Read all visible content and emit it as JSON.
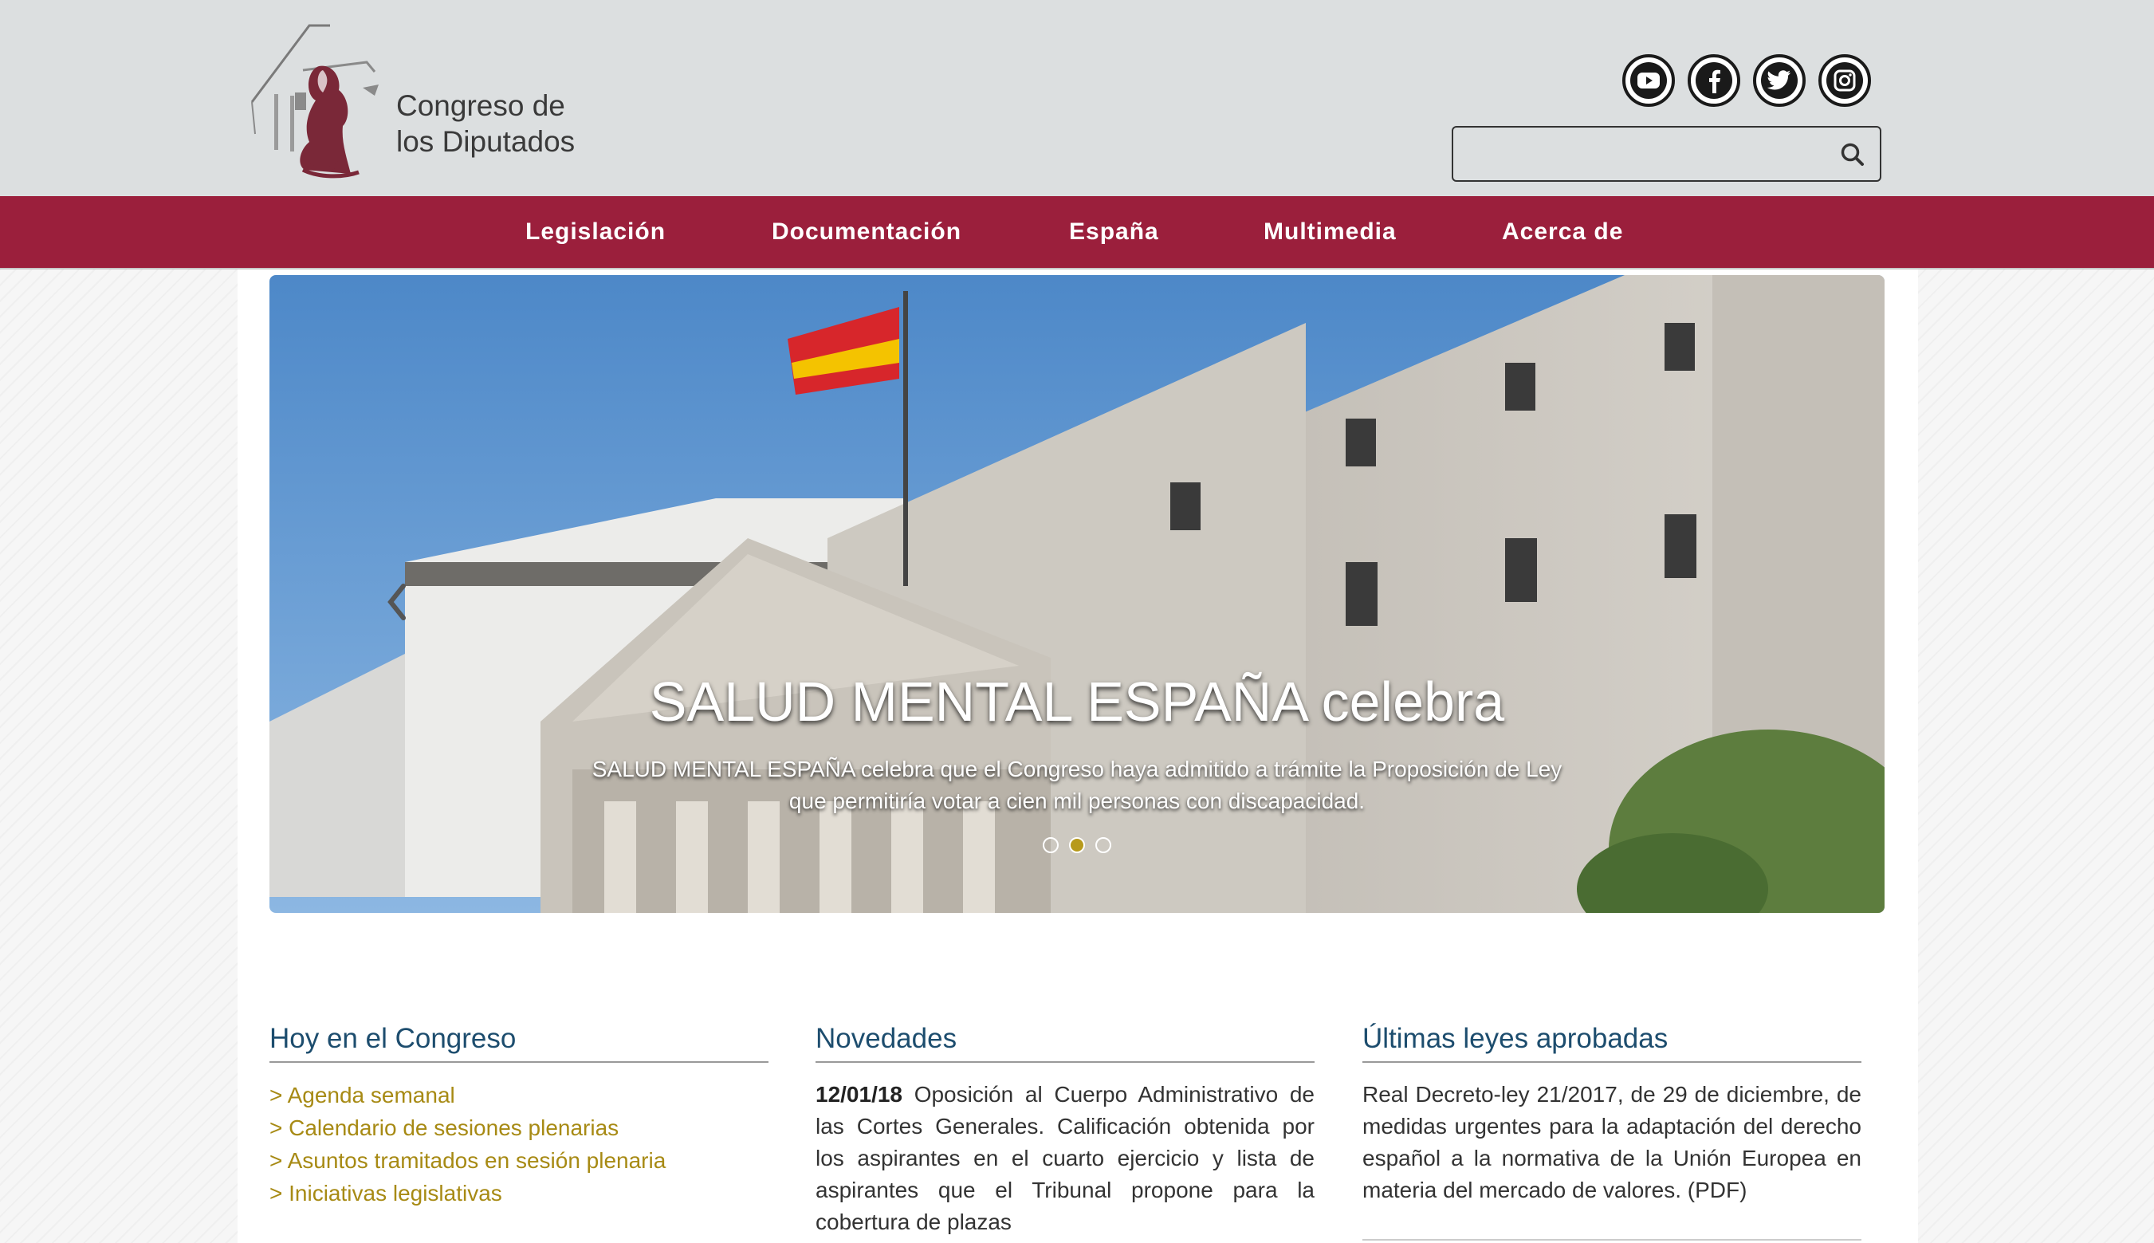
{
  "header": {
    "logo_line1": "Congreso de",
    "logo_line2": "los Diputados",
    "social": [
      "youtube-icon",
      "facebook-icon",
      "twitter-icon",
      "instagram-icon"
    ],
    "search": {
      "value": "",
      "placeholder": ""
    }
  },
  "nav": {
    "items": [
      "Legislación",
      "Documentación",
      "España",
      "Multimedia",
      "Acerca de"
    ]
  },
  "carousel": {
    "title": "SALUD MENTAL ESPAÑA celebra",
    "caption": "SALUD MENTAL ESPAÑA celebra que el Congreso haya admitido a trámite la Proposición de Ley que permitiría votar a cien mil personas con discapacidad.",
    "slides_total": 3,
    "active_slide": 2,
    "active_dot_color": "#b79a1c"
  },
  "sections": {
    "hoy": {
      "title": "Hoy en el Congreso",
      "links": [
        "> Agenda semanal",
        "> Calendario de sesiones plenarias",
        "> Asuntos tramitados en sesión plenaria",
        "> Iniciativas legislativas"
      ]
    },
    "novedades": {
      "title": "Novedades",
      "date": "12/01/18",
      "text": "Oposición al Cuerpo Administrativo de las Cortes Generales. Calificación obtenida por los aspirantes en el cuarto ejercicio y lista de aspirantes que el Tribunal propone para la cobertura de plazas"
    },
    "leyes": {
      "title": "Últimas leyes aprobadas",
      "text": "Real Decreto-ley 21/2017, de 29 de diciembre, de medidas urgentes para la adaptación del derecho español a la normativa de la Unión Europea en materia del mercado de valores. (PDF)"
    }
  },
  "colors": {
    "nav_bg": "#9b1f3c",
    "header_bg": "#dcdfe0",
    "section_title": "#1d4d6e",
    "link": "#a78a14"
  }
}
